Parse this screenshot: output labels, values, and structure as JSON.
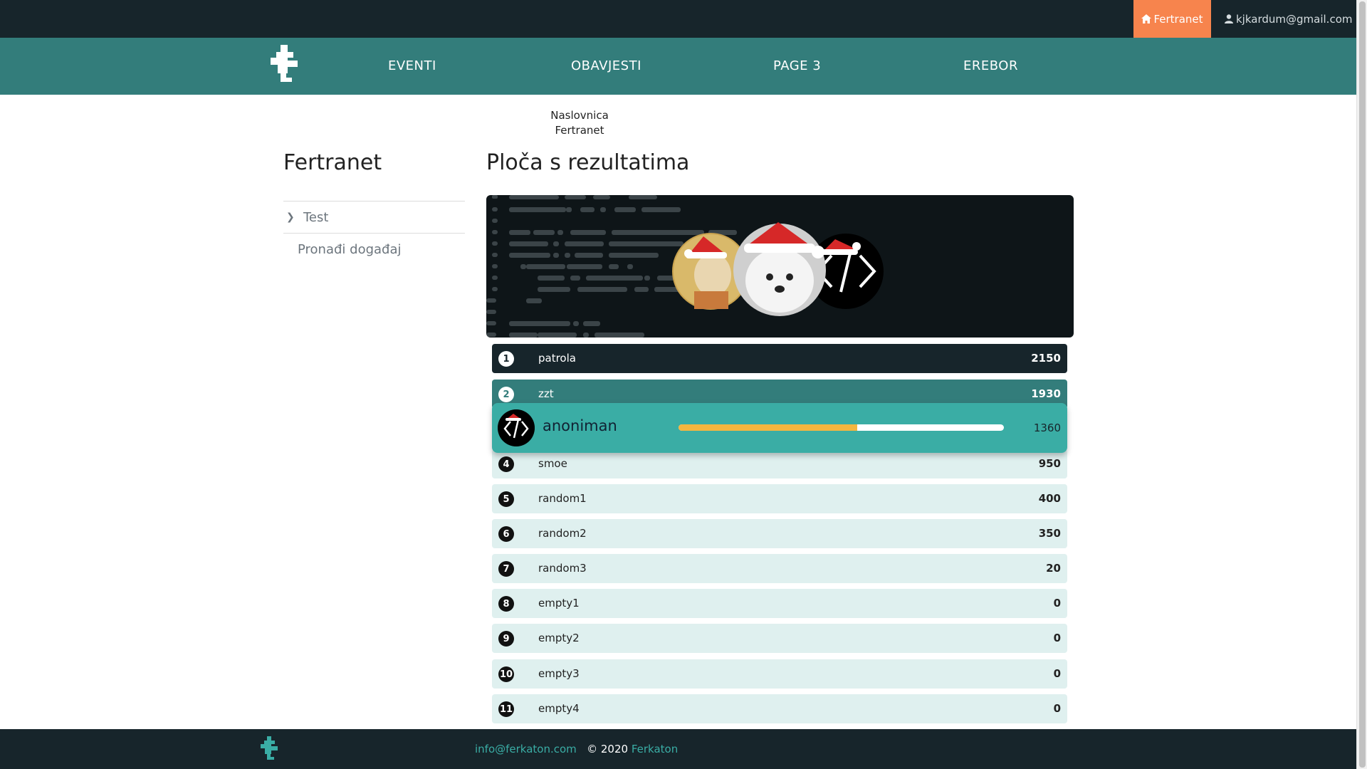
{
  "topbar": {
    "brand_label": "Fertranet",
    "user_email": "kjkardum@gmail.com"
  },
  "nav": {
    "items": [
      "EVENTI",
      "OBAVJESTI",
      "PAGE 3",
      "EREBOR"
    ]
  },
  "breadcrumb": {
    "line1": "Naslovnica",
    "line2": "Fertranet"
  },
  "sidebar": {
    "title": "Fertranet",
    "items": [
      {
        "label": "Test"
      },
      {
        "label": "Pronađi događaj"
      }
    ]
  },
  "main": {
    "title": "Ploča s rezultatima"
  },
  "leaderboard": {
    "rows": [
      {
        "rank": "1",
        "name": "patrola",
        "score": "2150"
      },
      {
        "rank": "2",
        "name": "zzt",
        "score": "1930"
      },
      {
        "rank": "4",
        "name": "smoe",
        "score": "950"
      },
      {
        "rank": "5",
        "name": "random1",
        "score": "400"
      },
      {
        "rank": "6",
        "name": "random2",
        "score": "350"
      },
      {
        "rank": "7",
        "name": "random3",
        "score": "20"
      },
      {
        "rank": "8",
        "name": "empty1",
        "score": "0"
      },
      {
        "rank": "9",
        "name": "empty2",
        "score": "0"
      },
      {
        "rank": "10",
        "name": "empty3",
        "score": "0"
      },
      {
        "rank": "11",
        "name": "empty4",
        "score": "0"
      }
    ],
    "current_user": {
      "name": "anoniman",
      "score": "1360",
      "progress_fraction": 0.55
    }
  },
  "footer": {
    "email": "info@ferkaton.com",
    "copyright": "© 2020",
    "org": "Ferkaton"
  },
  "colors": {
    "topbar": "#17252b",
    "navbar": "#337d7b",
    "accent": "#f7844d",
    "highlight": "#3aada5",
    "progress": "#f4b63f"
  }
}
